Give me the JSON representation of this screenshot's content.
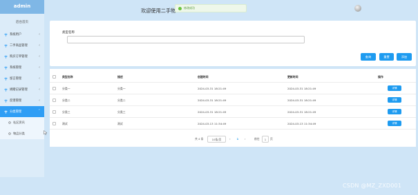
{
  "sidebar": {
    "brand": "admin",
    "home": "后台首页",
    "items": [
      {
        "label": "系统用户"
      },
      {
        "label": "二手商品管理"
      },
      {
        "label": "购买订单管理"
      },
      {
        "label": "系统管理"
      },
      {
        "label": "留言管理"
      },
      {
        "label": "捐赠记录管理"
      },
      {
        "label": "反馈管理"
      },
      {
        "label": "分类管理"
      }
    ],
    "sub_items": [
      {
        "label": "社区资讯"
      },
      {
        "label": "物品分类"
      }
    ]
  },
  "header": {
    "title": "欢迎使用二手物",
    "toast": "修改成功"
  },
  "search": {
    "label": "类型名称",
    "value": "",
    "query_btn": "查询",
    "reset_btn": "重置",
    "add_btn": "添加"
  },
  "table": {
    "columns": [
      "类型名称",
      "描述",
      "创建时间",
      "更新时间",
      "操作"
    ],
    "rows": [
      {
        "name": "分类一",
        "desc": "分类一",
        "created": "2024-03-31 18:21:49",
        "updated": "2024-03-31 18:21:49",
        "action": "详情"
      },
      {
        "name": "分类二",
        "desc": "分类二",
        "created": "2024-03-31 18:21:49",
        "updated": "2024-03-31 18:21:49",
        "action": "详情"
      },
      {
        "name": "分类三",
        "desc": "分类三",
        "created": "2024-03-31 18:21:49",
        "updated": "2024-03-31 18:21:49",
        "action": "详情"
      },
      {
        "name": "测试",
        "desc": "测试",
        "created": "2024-03-13 11:34:49",
        "updated": "2024-03-13 11:34:49",
        "action": "详情"
      }
    ]
  },
  "pagination": {
    "total": "共 4 条",
    "page_size": "10条/页",
    "prev": "‹",
    "current": "1",
    "next": "›",
    "goto_label": "前往",
    "goto_value": "1",
    "page_suffix": "页"
  },
  "watermark": "CSDN @MZ_ZXD001",
  "colors": {
    "accent": "#1e9bf0",
    "sidebar_active": "#2f9ef5",
    "background": "#cfe5f7"
  }
}
